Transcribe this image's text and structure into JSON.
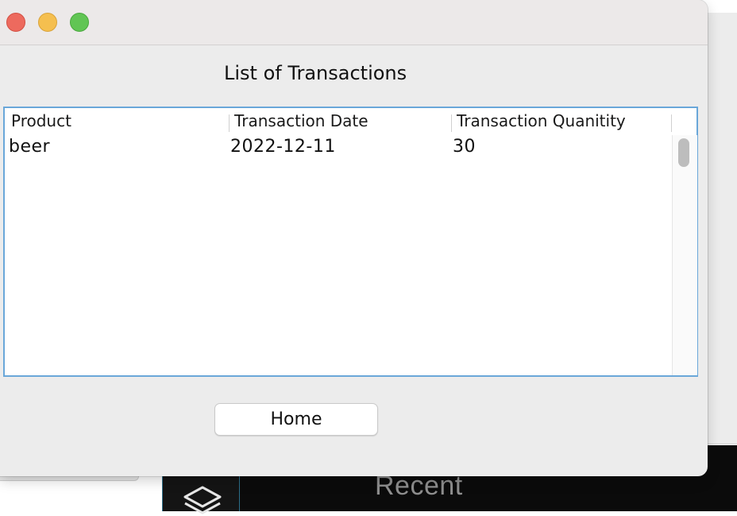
{
  "window": {
    "heading": "List of Transactions"
  },
  "table": {
    "columns": [
      "Product",
      "Transaction Date",
      "Transaction Quanitity"
    ],
    "rows": [
      {
        "product": "beer",
        "date": "2022-12-11",
        "quantity": "30"
      }
    ]
  },
  "buttons": {
    "home_label": "Home"
  },
  "background_app": {
    "section_label": "Recent",
    "icon": "layers-icon"
  },
  "colors": {
    "close": "#ed6a5e",
    "minimize": "#f5bf4f",
    "zoom": "#61c554",
    "table_focus_border": "#6aa7d9"
  }
}
